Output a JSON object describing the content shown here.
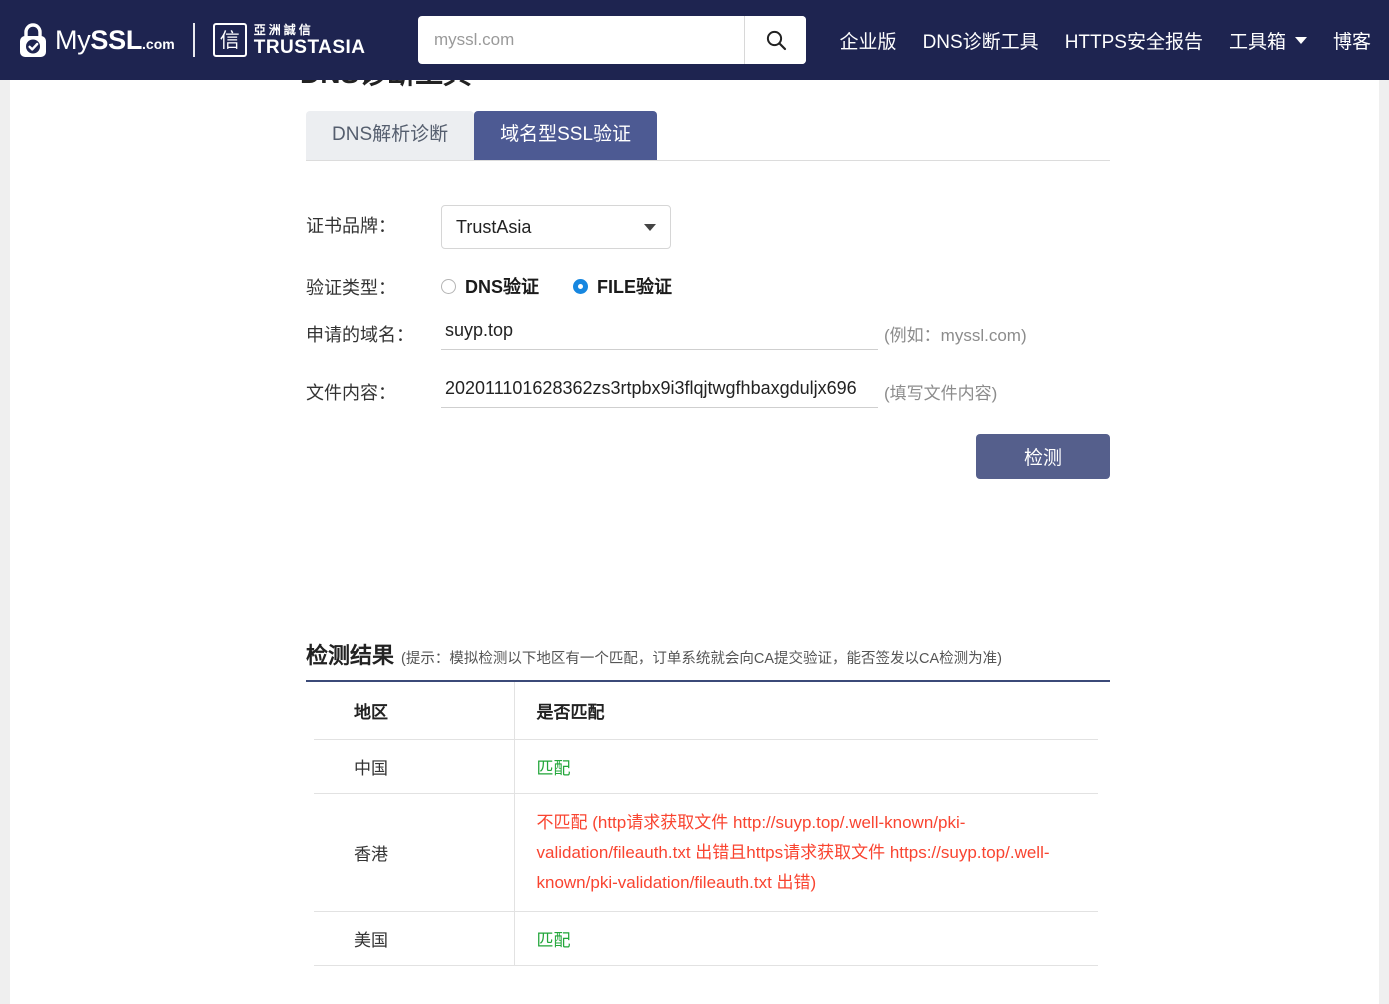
{
  "header": {
    "brand": {
      "my": "My",
      "ssl": "SSL",
      "dotcom": ".com",
      "lock_icon": "lock-icon"
    },
    "partner": {
      "mark": "信",
      "cn": "亞洲誠信",
      "en": "TRUSTASIA"
    },
    "search": {
      "placeholder": "myssl.com",
      "value": "",
      "icon": "search-icon"
    },
    "nav": [
      {
        "label": "企业版"
      },
      {
        "label": "DNS诊断工具"
      },
      {
        "label": "HTTPS安全报告"
      },
      {
        "label": "工具箱",
        "has_caret": true
      },
      {
        "label": "博客"
      }
    ],
    "bg_color": "#1e2450"
  },
  "page": {
    "title": "DNS诊断工具"
  },
  "tabs": [
    {
      "label": "DNS解析诊断",
      "active": false
    },
    {
      "label": "域名型SSL验证",
      "active": true
    }
  ],
  "form": {
    "brand": {
      "label": "证书品牌：",
      "value": "TrustAsia",
      "caret_icon": "chevron-down-icon"
    },
    "verify_type": {
      "label": "验证类型：",
      "options": [
        {
          "label": "DNS验证",
          "checked": false
        },
        {
          "label": "FILE验证",
          "checked": true
        }
      ]
    },
    "domain": {
      "label": "申请的域名：",
      "value": "suyp.top",
      "hint": "(例如：myssl.com)"
    },
    "file_content": {
      "label": "文件内容：",
      "value": "202011101628362zs3rtpbx9i3flqjtwgfhbaxgduljx696",
      "hint": "(填写文件内容)"
    },
    "submit_label": "检测",
    "submit_color": "#555f8c"
  },
  "results": {
    "title": "检测结果",
    "hint": "(提示：模拟检测以下地区有一个匹配，订单系统就会向CA提交验证，能否签发以CA检测为准)",
    "columns": [
      "地区",
      "是否匹配"
    ],
    "rows": [
      {
        "region": "中国",
        "status": "匹配",
        "ok": true
      },
      {
        "region": "香港",
        "status": "不匹配 (http请求获取文件 http://suyp.top/.well-known/pki-validation/fileauth.txt 出错且https请求获取文件 https://suyp.top/.well-known/pki-validation/fileauth.txt 出错)",
        "ok": false
      },
      {
        "region": "美国",
        "status": "匹配",
        "ok": true
      }
    ],
    "ok_color": "#22a63a",
    "bad_color": "#f94430"
  }
}
